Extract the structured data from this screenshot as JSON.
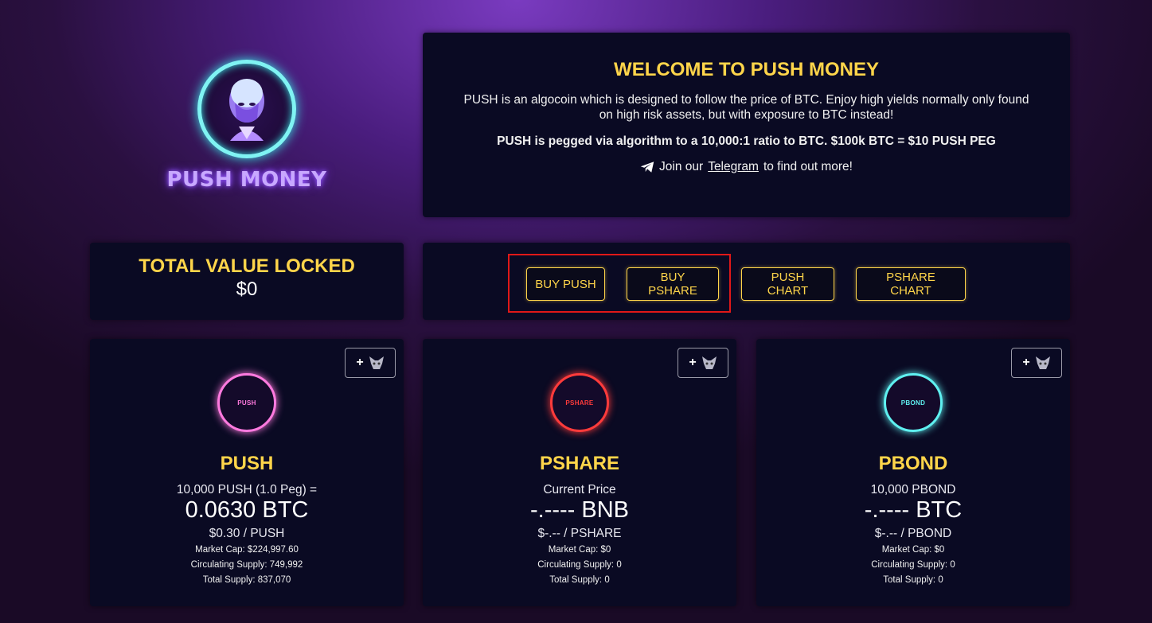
{
  "logo": {
    "text": "PUSH MONEY"
  },
  "welcome": {
    "title": "WELCOME TO PUSH MONEY",
    "description": "PUSH is an algocoin which is designed to follow the price of BTC. Enjoy high yields normally only found on high risk assets, but with exposure to BTC instead!",
    "peg": "PUSH is pegged via algorithm to a 10,000:1 ratio to BTC. $100k BTC = $10 PUSH PEG",
    "join_prefix": "Join our",
    "join_link": "Telegram",
    "join_suffix": "to find out more!",
    "icon": "telegram-icon"
  },
  "tvl": {
    "title": "TOTAL VALUE LOCKED",
    "value": "$0"
  },
  "buttons": {
    "buy_push": "BUY PUSH",
    "buy_pshare": "BUY PSHARE",
    "push_chart": "PUSH CHART",
    "pshare_chart": "PSHARE CHART"
  },
  "colors": {
    "accent": "#ffd54a",
    "panel": "#0a0a23",
    "highlight": "#e01818"
  },
  "cards": [
    {
      "add_label": "+",
      "logo_text": "PUSH",
      "logo_color": "#ff7adf",
      "name": "PUSH",
      "sub": "10,000 PUSH (1.0 Peg) =",
      "price": "0.0630 BTC",
      "per": "$0.30 / PUSH",
      "market_cap": "Market Cap: $224,997.60",
      "circulating": "Circulating Supply: 749,992",
      "total": "Total Supply: 837,070"
    },
    {
      "add_label": "+",
      "logo_text": "PSHARE",
      "logo_color": "#ff3b3b",
      "name": "PSHARE",
      "sub": "Current Price",
      "price": "-.---- BNB",
      "per": "$-.-- / PSHARE",
      "market_cap": "Market Cap: $0",
      "circulating": "Circulating Supply: 0",
      "total": "Total Supply: 0"
    },
    {
      "add_label": "+",
      "logo_text": "PBOND",
      "logo_color": "#5ff0f0",
      "name": "PBOND",
      "sub": "10,000 PBOND",
      "price": "-.---- BTC",
      "per": "$-.-- / PBOND",
      "market_cap": "Market Cap: $0",
      "circulating": "Circulating Supply: 0",
      "total": "Total Supply: 0"
    }
  ]
}
